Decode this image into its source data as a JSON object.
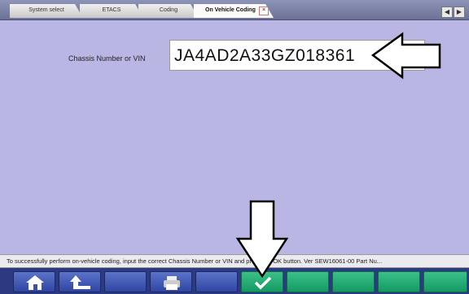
{
  "tabs": [
    {
      "label": "System select",
      "state": "inactive"
    },
    {
      "label": "ETACS",
      "state": "inactive"
    },
    {
      "label": "Coding",
      "state": "inactive"
    },
    {
      "label": "On Vehicle Coding",
      "state": "active"
    }
  ],
  "tab_close_symbol": "×",
  "nav": {
    "prev_symbol": "◀",
    "next_symbol": "▶"
  },
  "form": {
    "vin_label": "Chassis Number or VIN",
    "vin_value": "JA4AD2A33GZ018361"
  },
  "status_text": "To successfully perform on-vehicle coding, input the correct Chassis Number or VIN and press the OK button. Ver SEW16061-00 Part Nu...",
  "toolbar": {
    "buttons": [
      {
        "icon": "home-icon"
      },
      {
        "icon": "back-arrow-icon"
      },
      {
        "icon": "none"
      },
      {
        "icon": "printer-icon"
      },
      {
        "icon": "none"
      },
      {
        "icon": "ok-check-icon"
      },
      {
        "icon": "none"
      },
      {
        "icon": "none"
      },
      {
        "icon": "none"
      },
      {
        "icon": "none"
      }
    ]
  },
  "colors": {
    "content_bg": "#b9b6e4",
    "toolbar_blue": "#2f46a3",
    "toolbar_green": "#159a63"
  }
}
